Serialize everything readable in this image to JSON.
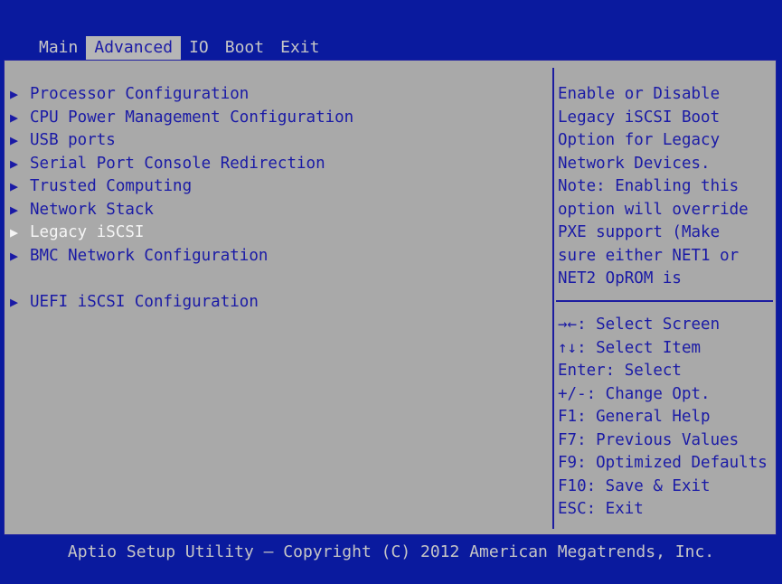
{
  "tabs": [
    {
      "label": "Main"
    },
    {
      "label": "Advanced"
    },
    {
      "label": "IO"
    },
    {
      "label": "Boot"
    },
    {
      "label": "Exit"
    }
  ],
  "menu_items": [
    {
      "label": "Processor Configuration"
    },
    {
      "label": "CPU Power Management Configuration"
    },
    {
      "label": "USB ports"
    },
    {
      "label": "Serial Port Console Redirection"
    },
    {
      "label": "Trusted Computing"
    },
    {
      "label": "Network Stack"
    },
    {
      "label": "Legacy iSCSI"
    },
    {
      "label": "BMC Network Configuration"
    },
    {
      "label": "UEFI iSCSI Configuration"
    }
  ],
  "arrow_glyph": "▶",
  "help_lines": [
    "Enable or Disable",
    "Legacy iSCSI Boot",
    "Option for Legacy",
    "Network Devices.",
    "Note: Enabling this",
    "option will override",
    "PXE support (Make",
    "sure either NET1 or",
    "NET2 OpROM is"
  ],
  "key_help": [
    "→←: Select Screen",
    "↑↓: Select Item",
    "Enter: Select",
    "+/-: Change Opt.",
    "F1: General Help",
    "F7: Previous Values",
    "F9: Optimized Defaults",
    "F10: Save & Exit",
    "ESC: Exit"
  ],
  "footer": "Aptio Setup Utility – Copyright (C) 2012 American Megatrends, Inc.",
  "colors": {
    "background": "#0a1a9e",
    "panel": "#a9a9a9",
    "text": "#1a1aa6",
    "selected_text": "#f5f5f5"
  }
}
